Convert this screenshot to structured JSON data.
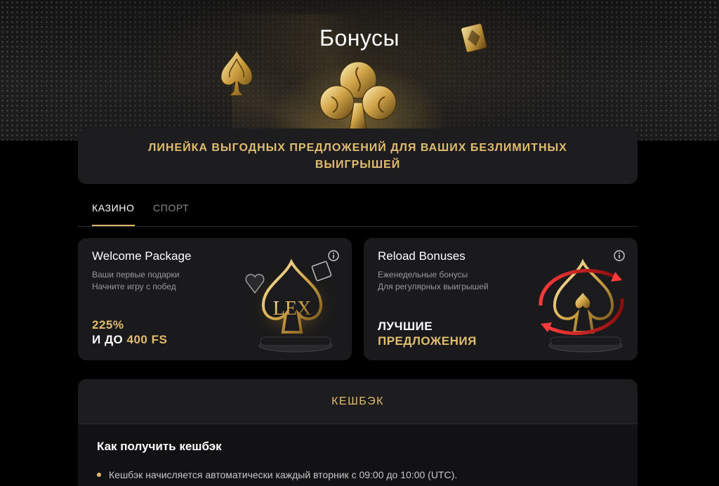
{
  "hero": {
    "title": "Бонусы",
    "subtitle": "ЛИНЕЙКА ВЫГОДНЫХ ПРЕДЛОЖЕНИЙ ДЛЯ ВАШИХ БЕЗЛИМИТНЫХ ВЫИГРЫШЕЙ"
  },
  "tabs": [
    {
      "label": "КАЗИНО",
      "active": true
    },
    {
      "label": "СПОРТ",
      "active": false
    }
  ],
  "cards": [
    {
      "title": "Welcome Package",
      "desc": [
        "Ваши первые подарки",
        "Начните игру с побед"
      ],
      "offer_line1": "225%",
      "offer_line2_prefix": "И ДО ",
      "offer_line2_highlight": "400 FS",
      "art_text": "LEX"
    },
    {
      "title": "Reload Bonuses",
      "desc": [
        "Еженедельные бонусы",
        "Для регулярных выигрышей"
      ],
      "offer_line1": "ЛУЧШИЕ",
      "offer_line2": "ПРЕДЛОЖЕНИЯ"
    }
  ],
  "cashback": {
    "header": "КЕШБЭК",
    "subtitle": "Как получить кешбэк",
    "items": [
      "Кешбэк начисляется автоматически каждый вторник с 09:00 до 10:00 (UTC)."
    ]
  },
  "colors": {
    "accent": "#e1bd70",
    "background": "#000000",
    "card": "#1a1a1c",
    "banner": "#1d1d1f"
  },
  "icons": [
    "spade-icon",
    "club-icon",
    "diamond-icon",
    "info-icon",
    "info-icon",
    "heart-icon",
    "spade-trophy-icon"
  ]
}
